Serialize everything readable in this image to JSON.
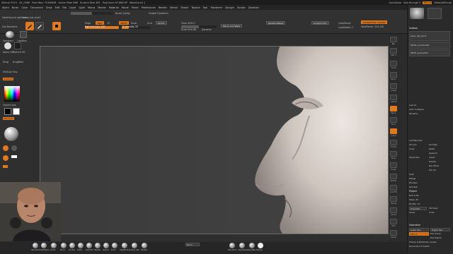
{
  "titlebar": {
    "items": [
      "ZBrush 2019",
      "Q5_0568",
      "Free Mem 79.858GB",
      "Active Mem 866",
      "Scratch Disk 381",
      "PolyCount 67,888 KP",
      "MeshCount 1"
    ],
    "right": [
      "QuickSave",
      "See-through 0",
      "Menus",
      "DefaultZScript"
    ]
  },
  "menubar": {
    "items": [
      "Alpha",
      "Brush",
      "Color",
      "Document",
      "Draw",
      "Edit",
      "File",
      "Layer",
      "Light",
      "Macro",
      "Marker",
      "Material",
      "Movie",
      "Picker",
      "Preferences",
      "Render",
      "Stencil",
      "Stroke",
      "Texture",
      "Tool",
      "Transform",
      "Zplugin",
      "Zscript",
      "Zonation"
    ]
  },
  "shelf": {
    "lightbox": "Switching to Lightbox > ",
    "tool_name": "asian_hat_short",
    "use_numbers": "Use Numbers",
    "zcut": "Zcut",
    "mrgb": "Mrgb",
    "rgb": "Rgb",
    "m_label": "M",
    "zadd": "Zadd",
    "zsub": "Zsub",
    "rgb_intensity": "Rgb Intensity 100",
    "z_intensity": "Z Intensity 25",
    "focal_shift": "Focal Shift 0",
    "draw_size": "Draw Size 68",
    "dynamic": "Dynamic",
    "active_points": "ActivePoints: 70,444",
    "total_points": "TotalPoints: 224,192",
    "lazy_mouse": "LazyMouse",
    "lazy_radius": "LazyRadius 1",
    "backface": "BackfaceMask",
    "sculptris": "Sculptris Pro",
    "gizmo": "Gizmo",
    "brush_config": "Brush Config",
    "enable_transform": "Enable Transform",
    "mirror_weld": "Mirror And Weld"
  },
  "left_tray": {
    "lightbox": "Lightbox",
    "dynamesh_label": "Standard",
    "brush_label": "Standard",
    "alpha_label": "Alpha Off",
    "texture_label": "Texture Off",
    "drag": "Drag",
    "stroke": "DragRect",
    "material_label": "MatCap Gray",
    "gradient": "Gradient",
    "switch_color": "SwitchColor",
    "alternate": "Alternate"
  },
  "right_icons": [
    "Bpr",
    "SPix 3",
    "Scroll",
    "Zoom",
    "Actual",
    "AAHalf",
    "Persp",
    "Floor",
    "L.Sym",
    "Frame",
    "Move",
    "Scale",
    "Rotate",
    "Line Fill",
    "Transp",
    "Ghost",
    "Solo",
    "Xpose"
  ],
  "right_panel": {
    "subtools_title": "Subtool",
    "subtool_items": [
      "asian_hat_short",
      "PM3D_Cylinder3D1",
      "PM3D_Sphere3D1"
    ],
    "rows": [
      "List All",
      "Auto Collapse",
      "Rename",
      "AutoReorder",
      "All Low",
      "All High",
      "Copy",
      "Paste",
      "Append",
      "Duplicate",
      "Insert",
      "Delete",
      "Del Other",
      "Del All",
      "Split",
      "Merge",
      "Boolean",
      "Remesh",
      "Project",
      "Extract",
      "Geometry",
      "Lower Res",
      "Higher Res",
      "Divide",
      "Smt",
      "Suv",
      "ReUV"
    ],
    "project_label": "Project",
    "dist": "Dist 0.02",
    "mean": "Mean 25",
    "pa_blur": "PA Blur 10",
    "project_all": "ProjectAll",
    "farthest": "Farthest",
    "outer": "Outer",
    "inner": "Inner",
    "geometry_label": "Geometry",
    "sdiv": "SDiv 4",
    "del_lower": "Del Lower",
    "del_higher": "Del Higher",
    "freeze": "Freeze SubDivision Levels",
    "reconstruct": "Reconstruct Subdiv"
  },
  "bottom": {
    "brushes": [
      "Standard",
      "ClayTubes",
      "Polish",
      "Move",
      "TrimDy",
      "Inflat",
      "DamStd",
      "hPolish",
      "Slash3",
      "Pinch",
      "ClayBuildup",
      "Dam_Std",
      "hPolish"
    ],
    "right_brushes": [
      "Standard",
      "ClayTubes",
      "SelectRect"
    ],
    "mid_label": "Mirror",
    "xpose": "XPose"
  }
}
